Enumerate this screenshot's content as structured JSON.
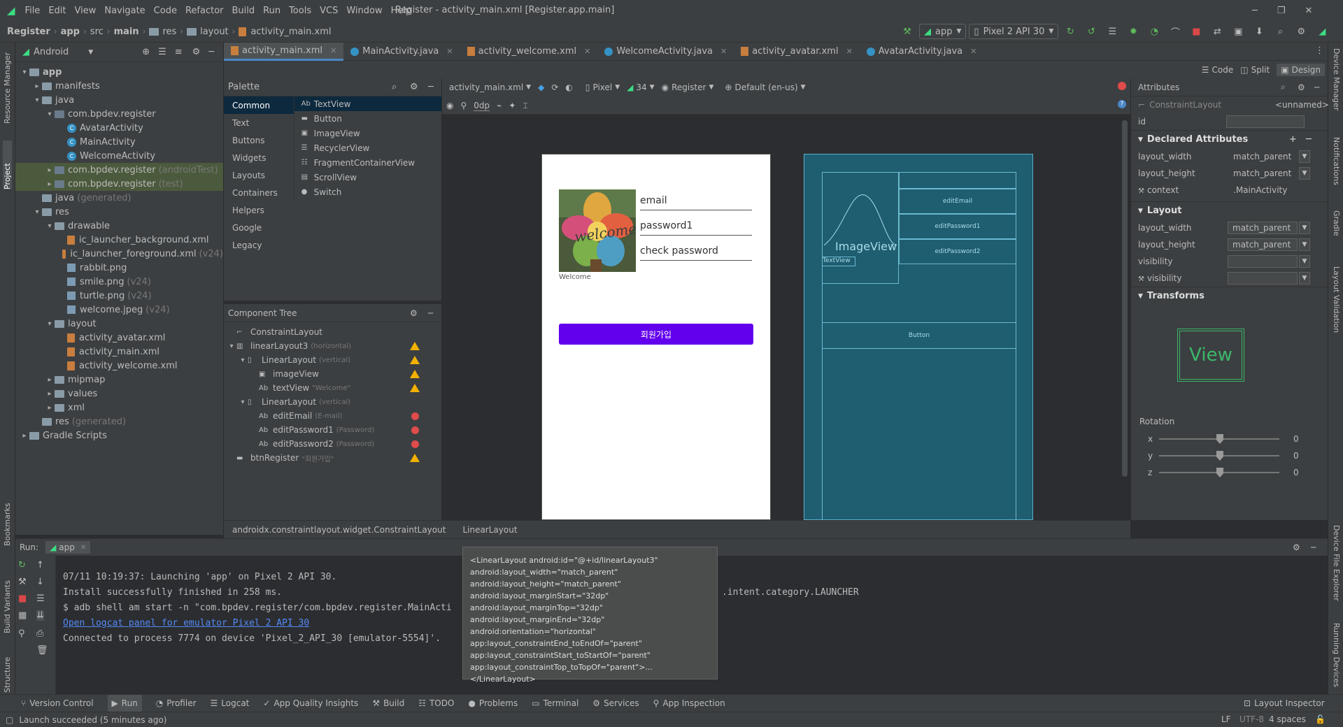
{
  "menubar": {
    "items": [
      "File",
      "Edit",
      "View",
      "Navigate",
      "Code",
      "Refactor",
      "Build",
      "Run",
      "Tools",
      "VCS",
      "Window",
      "Help"
    ],
    "title": "Register - activity_main.xml [Register.app.main]"
  },
  "nav": {
    "breadcrumbs": [
      "Register",
      "app",
      "src",
      "main",
      "res",
      "layout",
      "activity_main.xml"
    ],
    "run_config": "app",
    "device": "Pixel 2 API 30"
  },
  "project": {
    "view": "Android",
    "tree": [
      {
        "label": "app",
        "indent": 0,
        "type": "folder",
        "arrow": "▾",
        "bold": true
      },
      {
        "label": "manifests",
        "indent": 1,
        "type": "folder",
        "arrow": "▸"
      },
      {
        "label": "java",
        "indent": 1,
        "type": "folder",
        "arrow": "▾"
      },
      {
        "label": "com.bpdev.register",
        "indent": 2,
        "type": "pkg",
        "arrow": "▾"
      },
      {
        "label": "AvatarActivity",
        "indent": 3,
        "type": "class"
      },
      {
        "label": "MainActivity",
        "indent": 3,
        "type": "class"
      },
      {
        "label": "WelcomeActivity",
        "indent": 3,
        "type": "class"
      },
      {
        "label": "com.bpdev.register",
        "suffix": "(androidTest)",
        "indent": 2,
        "type": "pkg",
        "arrow": "▸",
        "sel": true
      },
      {
        "label": "com.bpdev.register",
        "suffix": "(test)",
        "indent": 2,
        "type": "pkg",
        "arrow": "▸",
        "sel": true
      },
      {
        "label": "java",
        "suffix": "(generated)",
        "indent": 1,
        "type": "folder"
      },
      {
        "label": "res",
        "indent": 1,
        "type": "folder",
        "arrow": "▾"
      },
      {
        "label": "drawable",
        "indent": 2,
        "type": "folder",
        "arrow": "▾"
      },
      {
        "label": "ic_launcher_background.xml",
        "indent": 3,
        "type": "xml"
      },
      {
        "label": "ic_launcher_foreground.xml",
        "suffix": "(v24)",
        "indent": 3,
        "type": "xml"
      },
      {
        "label": "rabbit.png",
        "indent": 3,
        "type": "img"
      },
      {
        "label": "smile.png",
        "suffix": "(v24)",
        "indent": 3,
        "type": "img"
      },
      {
        "label": "turtle.png",
        "suffix": "(v24)",
        "indent": 3,
        "type": "img"
      },
      {
        "label": "welcome.jpeg",
        "suffix": "(v24)",
        "indent": 3,
        "type": "img"
      },
      {
        "label": "layout",
        "indent": 2,
        "type": "folder",
        "arrow": "▾"
      },
      {
        "label": "activity_avatar.xml",
        "indent": 3,
        "type": "xml"
      },
      {
        "label": "activity_main.xml",
        "indent": 3,
        "type": "xml"
      },
      {
        "label": "activity_welcome.xml",
        "indent": 3,
        "type": "xml"
      },
      {
        "label": "mipmap",
        "indent": 2,
        "type": "folder",
        "arrow": "▸"
      },
      {
        "label": "values",
        "indent": 2,
        "type": "folder",
        "arrow": "▸"
      },
      {
        "label": "xml",
        "indent": 2,
        "type": "folder",
        "arrow": "▸"
      },
      {
        "label": "res",
        "suffix": "(generated)",
        "indent": 1,
        "type": "folder"
      },
      {
        "label": "Gradle Scripts",
        "indent": 0,
        "type": "folder",
        "arrow": "▸"
      }
    ]
  },
  "tabs": [
    {
      "label": "activity_main.xml",
      "type": "xml",
      "active": true
    },
    {
      "label": "MainActivity.java",
      "type": "class"
    },
    {
      "label": "activity_welcome.xml",
      "type": "xml"
    },
    {
      "label": "WelcomeActivity.java",
      "type": "class"
    },
    {
      "label": "activity_avatar.xml",
      "type": "xml"
    },
    {
      "label": "AvatarActivity.java",
      "type": "class"
    }
  ],
  "view_modes": {
    "code": "Code",
    "split": "Split",
    "design": "Design"
  },
  "palette": {
    "title": "Palette",
    "categories": [
      "Common",
      "Text",
      "Buttons",
      "Widgets",
      "Layouts",
      "Containers",
      "Helpers",
      "Google",
      "Legacy"
    ],
    "items": [
      {
        "icon": "Ab",
        "label": "TextView"
      },
      {
        "icon": "▬",
        "label": "Button"
      },
      {
        "icon": "▣",
        "label": "ImageView"
      },
      {
        "icon": "☰",
        "label": "RecyclerView"
      },
      {
        "icon": "☷",
        "label": "FragmentContainerView"
      },
      {
        "icon": "▤",
        "label": "ScrollView"
      },
      {
        "icon": "●",
        "label": "Switch"
      }
    ]
  },
  "design_toolbar": {
    "file": "activity_main.xml",
    "device": "Pixel",
    "api": "34",
    "theme": "Register",
    "locale": "Default (en-us)",
    "margin": "0dp"
  },
  "component_tree": {
    "title": "Component Tree",
    "rows": [
      {
        "icon": "⌐",
        "label": "ConstraintLayout",
        "indent": 0,
        "arrow": ""
      },
      {
        "icon": "▥",
        "label": "linearLayout3",
        "suffix": "(horizontal)",
        "indent": 0,
        "arrow": "▾",
        "status": "warn"
      },
      {
        "icon": "▯",
        "label": "LinearLayout",
        "suffix": "(vertical)",
        "indent": 1,
        "arrow": "▾",
        "status": "warn"
      },
      {
        "icon": "▣",
        "label": "imageView",
        "indent": 2,
        "arrow": "",
        "status": "warn"
      },
      {
        "icon": "Ab",
        "label": "textView",
        "suffix": "\"Welcome\"",
        "indent": 2,
        "arrow": "",
        "status": "warn"
      },
      {
        "icon": "▯",
        "label": "LinearLayout",
        "suffix": "(vertical)",
        "indent": 1,
        "arrow": "▾"
      },
      {
        "icon": "Ab",
        "label": "editEmail",
        "suffix": "(E-mail)",
        "indent": 2,
        "arrow": "",
        "status": "err"
      },
      {
        "icon": "Ab",
        "label": "editPassword1",
        "suffix": "(Password)",
        "indent": 2,
        "arrow": "",
        "status": "err"
      },
      {
        "icon": "Ab",
        "label": "editPassword2",
        "suffix": "(Password)",
        "indent": 2,
        "arrow": "",
        "status": "err"
      },
      {
        "icon": "▬",
        "label": "btnRegister",
        "suffix": "\"회원가입\"",
        "indent": 0,
        "arrow": "",
        "status": "warn"
      }
    ]
  },
  "preview": {
    "fields": [
      "email",
      "password1",
      "check password"
    ],
    "image_caption": "Welcome",
    "button": "회원가입",
    "accent": "#6200ee"
  },
  "blueprint": {
    "image_label": "ImageView",
    "text_label": "TextView",
    "fields": [
      "editEmail",
      "editPassword1",
      "editPassword2"
    ],
    "button": "Button"
  },
  "attributes": {
    "title": "Attributes",
    "component": "ConstraintLayout",
    "name": "<unnamed>",
    "id_label": "id",
    "declared_title": "Declared Attributes",
    "declared": [
      {
        "name": "layout_width",
        "value": "match_parent"
      },
      {
        "name": "layout_height",
        "value": "match_parent"
      },
      {
        "name": "context",
        "value": ".MainActivity"
      }
    ],
    "layout_title": "Layout",
    "layout": [
      {
        "name": "layout_width",
        "value": "match_parent"
      },
      {
        "name": "layout_height",
        "value": "match_parent"
      },
      {
        "name": "visibility",
        "value": ""
      },
      {
        "name": "visibility",
        "value": ""
      }
    ],
    "transforms_title": "Transforms",
    "view_preview": "View",
    "rotation_title": "Rotation",
    "rotation": [
      {
        "axis": "x",
        "value": "0"
      },
      {
        "axis": "y",
        "value": "0"
      },
      {
        "axis": "z",
        "value": "0"
      }
    ]
  },
  "editor_breadcrumb": [
    "androidx.constraintlayout.widget.ConstraintLayout",
    "LinearLayout"
  ],
  "run": {
    "label": "Run:",
    "tab": "app",
    "lines": [
      {
        "text": "07/11 10:19:37: Launching 'app' on Pixel 2 API 30.",
        "link": false
      },
      {
        "text": "Install successfully finished in 258 ms.",
        "link": false
      },
      {
        "text": "$ adb shell am start -n \"com.bpdev.register/com.bpdev.register.MainActi",
        "tail": ".intent.category.LAUNCHER",
        "link": false
      },
      {
        "text": "Open logcat panel for emulator Pixel 2 API 30",
        "link": true
      },
      {
        "text": "Connected to process 7774 on device 'Pixel_2_API_30 [emulator-5554]'.",
        "link": false
      }
    ]
  },
  "tooltip_lines": [
    "<LinearLayout android:id=\"@+id/linearLayout3\"",
    "android:layout_width=\"match_parent\"",
    "android:layout_height=\"match_parent\"",
    "android:layout_marginStart=\"32dp\"",
    "android:layout_marginTop=\"32dp\"",
    "android:layout_marginEnd=\"32dp\"",
    "android:orientation=\"horizontal\"",
    "app:layout_constraintEnd_toEndOf=\"parent\"",
    "app:layout_constraintStart_toStartOf=\"parent\"",
    "app:layout_constraintTop_toTopOf=\"parent\">...</LinearLayout>"
  ],
  "bottom_tools": [
    "Version Control",
    "Run",
    "Profiler",
    "Logcat",
    "App Quality Insights",
    "Build",
    "TODO",
    "Problems",
    "Terminal",
    "Services",
    "App Inspection"
  ],
  "bottom_right": "Layout Inspector",
  "left_tools": [
    "Resource Manager",
    "Project",
    "Bookmarks",
    "Build Variants",
    "Structure"
  ],
  "right_tools": [
    "Device Manager",
    "Notifications",
    "Gradle",
    "Layout Validation",
    "Device File Explorer",
    "Running Devices"
  ],
  "status": {
    "message": "Launch succeeded (5 minutes ago)",
    "line_sep": "LF",
    "encoding": "UTF-8",
    "indent": "4 spaces"
  }
}
